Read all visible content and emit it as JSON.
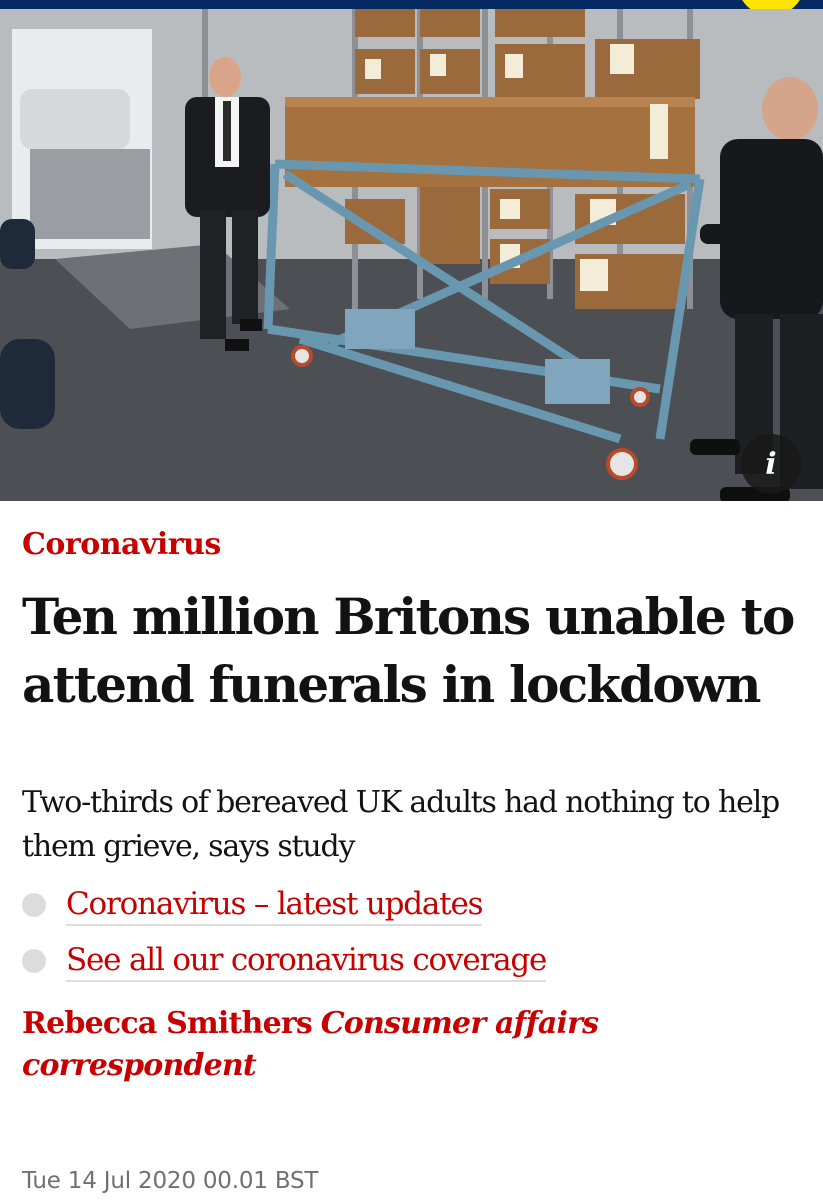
{
  "article": {
    "kicker": "Coronavirus",
    "headline": "Ten million Britons unable to attend funerals in lockdown",
    "standfirst": "Two-thirds of bereaved UK adults had nothing to help them grieve, says study",
    "related_links": [
      {
        "label": "Coronavirus – latest updates"
      },
      {
        "label": "See all our coronavirus coverage"
      }
    ],
    "byline": {
      "author": "Rebecca Smithers",
      "role": "Consumer affairs correspondent"
    },
    "dateline": "Tue 14 Jul 2020 00.01 BST"
  },
  "image": {
    "info_icon": "i",
    "info_icon_name": "info-icon"
  },
  "colors": {
    "accent": "#c70000",
    "masthead": "#052962",
    "highlight": "#ffe500"
  }
}
